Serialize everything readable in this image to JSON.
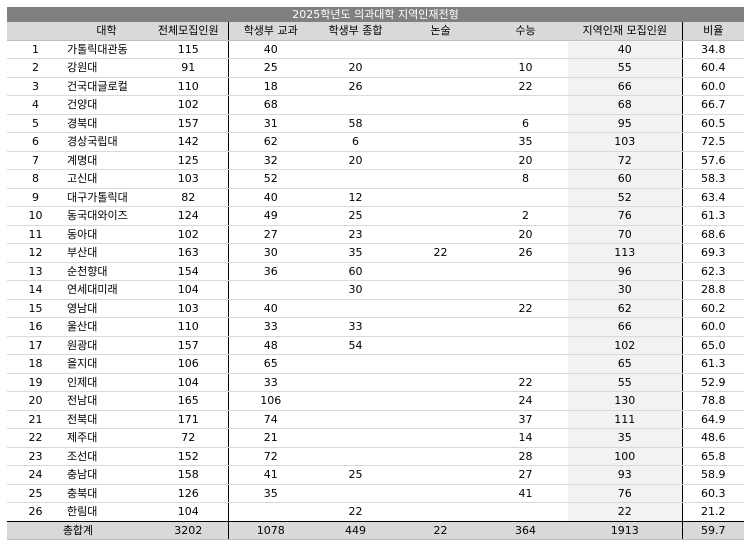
{
  "title": "2025학년도 의과대학 지역인재전형",
  "headers": [
    "",
    "대학",
    "전체모집인원",
    "학생부 교과",
    "학생부 종합",
    "논술",
    "수능",
    "지역인재 모집인원",
    "비율"
  ],
  "rows": [
    [
      "1",
      "가톨릭대관동",
      "115",
      "40",
      "",
      "",
      "",
      "40",
      "34.8"
    ],
    [
      "2",
      "강원대",
      "91",
      "25",
      "20",
      "",
      "10",
      "55",
      "60.4"
    ],
    [
      "3",
      "건국대글로컬",
      "110",
      "18",
      "26",
      "",
      "22",
      "66",
      "60.0"
    ],
    [
      "4",
      "건양대",
      "102",
      "68",
      "",
      "",
      "",
      "68",
      "66.7"
    ],
    [
      "5",
      "경북대",
      "157",
      "31",
      "58",
      "",
      "6",
      "95",
      "60.5"
    ],
    [
      "6",
      "경상국립대",
      "142",
      "62",
      "6",
      "",
      "35",
      "103",
      "72.5"
    ],
    [
      "7",
      "계명대",
      "125",
      "32",
      "20",
      "",
      "20",
      "72",
      "57.6"
    ],
    [
      "8",
      "고신대",
      "103",
      "52",
      "",
      "",
      "8",
      "60",
      "58.3"
    ],
    [
      "9",
      "대구가톨릭대",
      "82",
      "40",
      "12",
      "",
      "",
      "52",
      "63.4"
    ],
    [
      "10",
      "동국대와이즈",
      "124",
      "49",
      "25",
      "",
      "2",
      "76",
      "61.3"
    ],
    [
      "11",
      "동아대",
      "102",
      "27",
      "23",
      "",
      "20",
      "70",
      "68.6"
    ],
    [
      "12",
      "부산대",
      "163",
      "30",
      "35",
      "22",
      "26",
      "113",
      "69.3"
    ],
    [
      "13",
      "순천향대",
      "154",
      "36",
      "60",
      "",
      "",
      "96",
      "62.3"
    ],
    [
      "14",
      "연세대미래",
      "104",
      "",
      "30",
      "",
      "",
      "30",
      "28.8"
    ],
    [
      "15",
      "영남대",
      "103",
      "40",
      "",
      "",
      "22",
      "62",
      "60.2"
    ],
    [
      "16",
      "울산대",
      "110",
      "33",
      "33",
      "",
      "",
      "66",
      "60.0"
    ],
    [
      "17",
      "원광대",
      "157",
      "48",
      "54",
      "",
      "",
      "102",
      "65.0"
    ],
    [
      "18",
      "을지대",
      "106",
      "65",
      "",
      "",
      "",
      "65",
      "61.3"
    ],
    [
      "19",
      "인제대",
      "104",
      "33",
      "",
      "",
      "22",
      "55",
      "52.9"
    ],
    [
      "20",
      "전남대",
      "165",
      "106",
      "",
      "",
      "24",
      "130",
      "78.8"
    ],
    [
      "21",
      "전북대",
      "171",
      "74",
      "",
      "",
      "37",
      "111",
      "64.9"
    ],
    [
      "22",
      "제주대",
      "72",
      "21",
      "",
      "",
      "14",
      "35",
      "48.6"
    ],
    [
      "23",
      "조선대",
      "152",
      "72",
      "",
      "",
      "28",
      "100",
      "65.8"
    ],
    [
      "24",
      "충남대",
      "158",
      "41",
      "25",
      "",
      "27",
      "93",
      "58.9"
    ],
    [
      "25",
      "충북대",
      "126",
      "35",
      "",
      "",
      "41",
      "76",
      "60.3"
    ],
    [
      "26",
      "한림대",
      "104",
      "",
      "22",
      "",
      "",
      "22",
      "21.2"
    ]
  ],
  "total": [
    "총합계",
    "3202",
    "1078",
    "449",
    "22",
    "364",
    "1913",
    "59.7"
  ]
}
